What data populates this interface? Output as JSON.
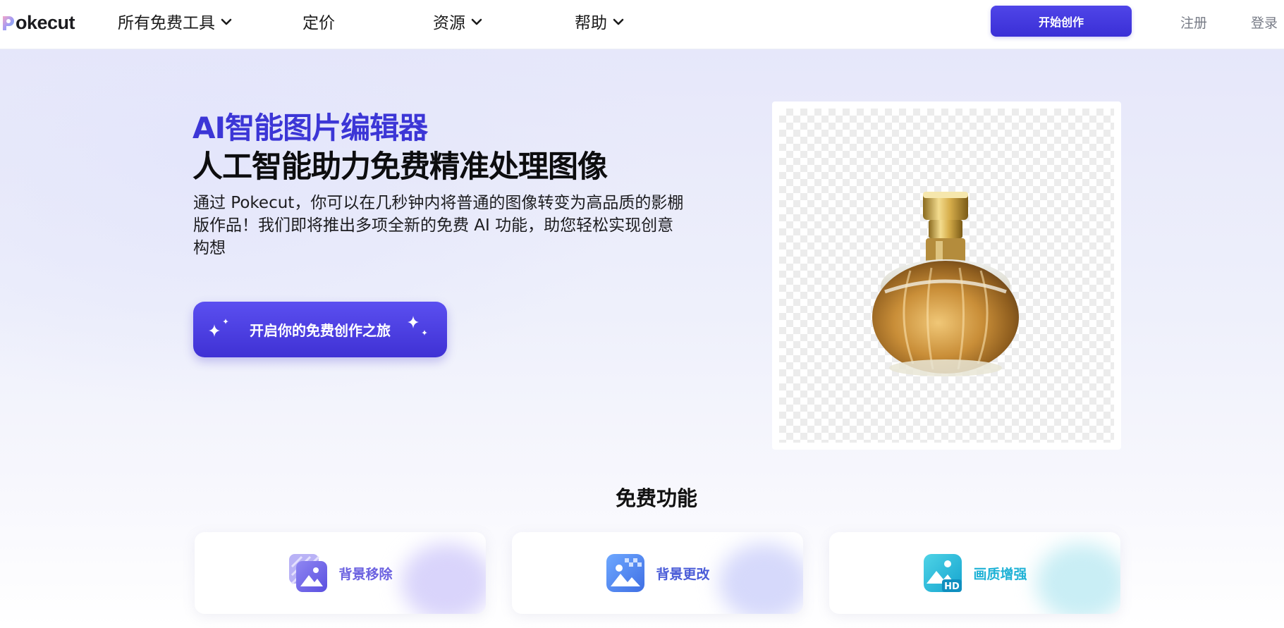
{
  "nav": {
    "logo_text": "okecut",
    "items": [
      {
        "label": "所有免费工具",
        "has_dropdown": true
      },
      {
        "label": "定价",
        "has_dropdown": false
      },
      {
        "label": "资源",
        "has_dropdown": true
      },
      {
        "label": "帮助",
        "has_dropdown": true
      }
    ],
    "start_button": "开始创作",
    "register": "注册",
    "login": "登录"
  },
  "hero": {
    "title_accent": "AI智能图片编辑器",
    "title": "人工智能助力免费精准处理图像",
    "description": "通过 Pokecut，你可以在几秒钟内将普通的图像转变为高品质的影棚版作品！我们即将推出多项全新的免费 AI 功能，助您轻松实现创意构想",
    "cta": "开启你的免费创作之旅"
  },
  "features": {
    "title": "免费功能",
    "cards": [
      {
        "label": "背景移除",
        "icon": "background-remove-icon",
        "color": "#6b61e0"
      },
      {
        "label": "背景更改",
        "icon": "background-change-icon",
        "color": "#4a5cd8"
      },
      {
        "label": "画质增强",
        "icon": "hd-enhance-icon",
        "color": "#1fb2d6"
      }
    ]
  },
  "colors": {
    "accent": "#3c36d6",
    "button": "#4338e0",
    "hero_bg": "#e6e7fa"
  }
}
